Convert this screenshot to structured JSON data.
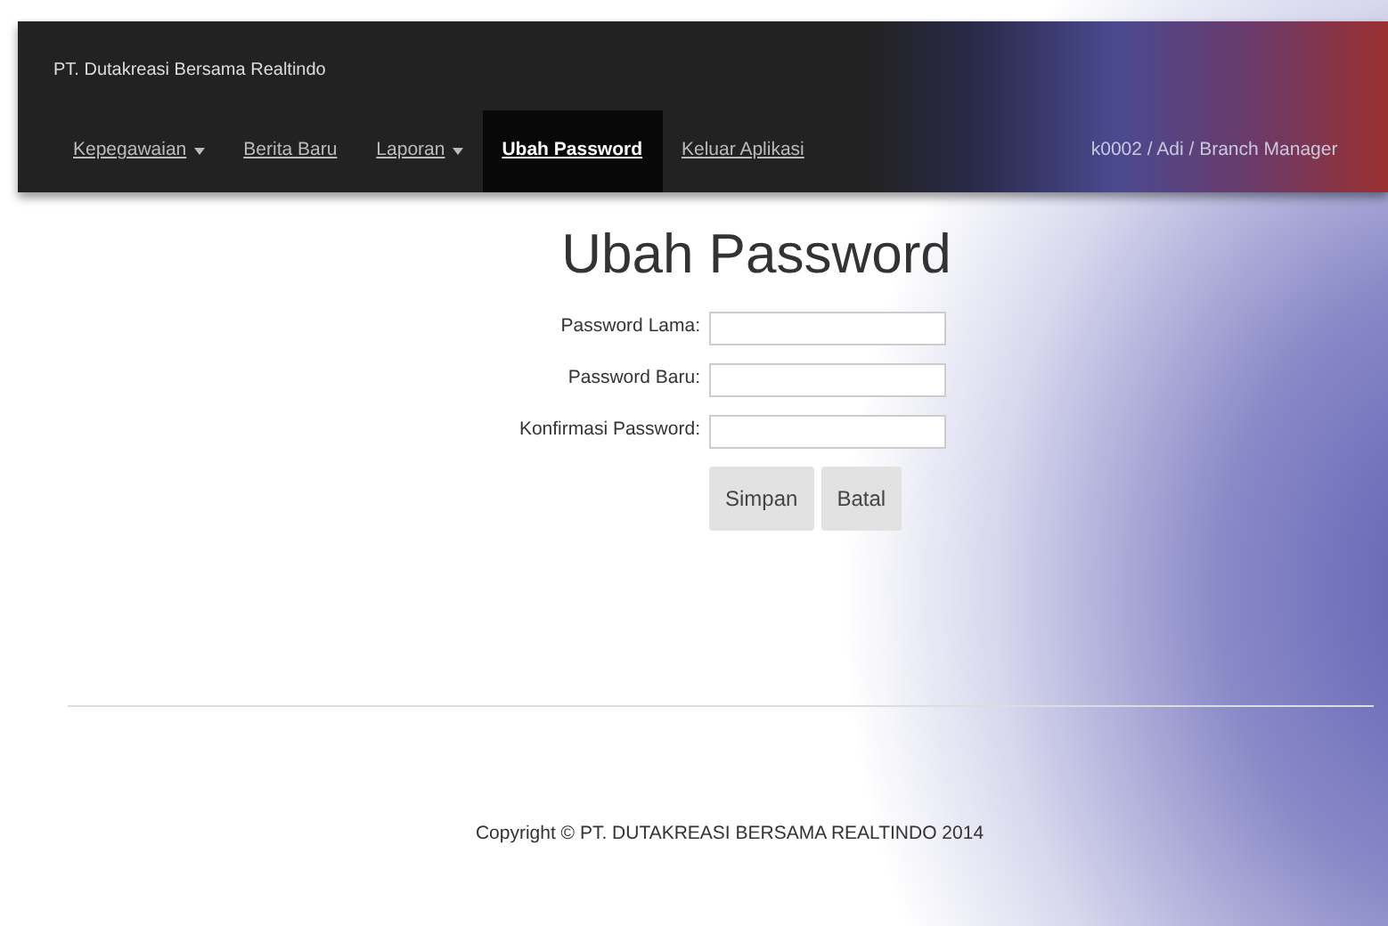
{
  "brand": "PT. Dutakreasi Bersama Realtindo",
  "nav": [
    {
      "label": "Kepegawaian",
      "kind": "dropdown",
      "selected": false
    },
    {
      "label": "Berita Baru",
      "kind": "link",
      "selected": false
    },
    {
      "label": "Laporan",
      "kind": "dropdown",
      "selected": false
    },
    {
      "label": "Ubah Password",
      "kind": "link",
      "selected": true
    },
    {
      "label": "Keluar Aplikasi",
      "kind": "link",
      "selected": false
    }
  ],
  "user": "k0002 / Adi / Branch Manager",
  "title": "Ubah Password",
  "fields": [
    {
      "label": "Password Lama:"
    },
    {
      "label": "Password Baru:"
    },
    {
      "label": "Konfirmasi Password:"
    }
  ],
  "buttons": [
    "Simpan",
    "Batal"
  ],
  "footer": "Copyright © PT. DUTAKREASI BERSAMA REALTINDO 2014"
}
